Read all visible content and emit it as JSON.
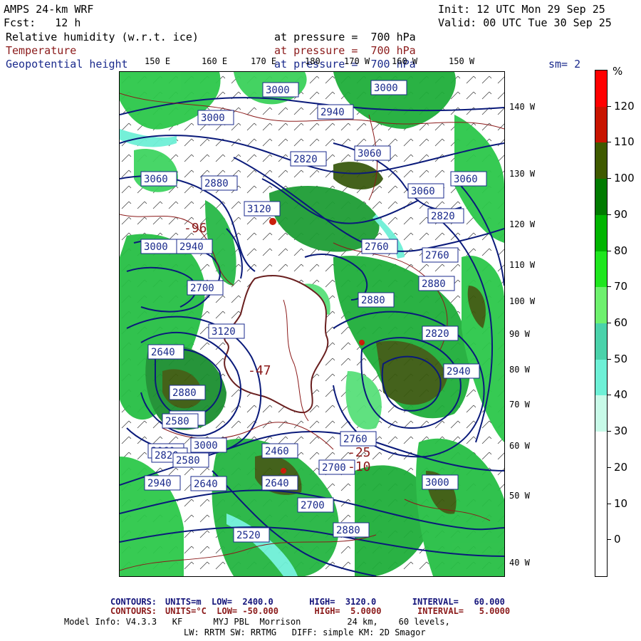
{
  "header": {
    "title": "AMPS 24-km WRF",
    "fcst": "Fcst:   12 h",
    "init": "Init: 12 UTC Mon 29 Sep 25",
    "valid": "Valid: 00 UTC Tue 30 Sep 25",
    "sm": "sm= 2"
  },
  "fields": [
    {
      "name": "Relative humidity (w.r.t. ice)",
      "pressure": "at pressure =  700 hPa",
      "color": "#000000"
    },
    {
      "name": "Temperature",
      "pressure": "at pressure =  700 hPa",
      "color": "#8b1a1a"
    },
    {
      "name": "Geopotential height",
      "pressure": "at pressure =  700 hPa",
      "color": "#1a2a8c"
    }
  ],
  "map": {
    "lon_labels": [
      "150 E",
      "160 E",
      "170 E",
      "180",
      "170 W",
      "160 W",
      "150 W"
    ],
    "lat_labels": [
      "140 W",
      "130 W",
      "120 W",
      "110 W",
      "100 W",
      "90 W",
      "80 W",
      "70 W",
      "60 W",
      "50 W",
      "40 W"
    ],
    "height_labels": [
      "3000",
      "3000",
      "3000",
      "2940",
      "3060",
      "3060",
      "2820",
      "3060",
      "2880",
      "3060",
      "3120",
      "2820",
      "2760",
      "2760",
      "3000",
      "2940",
      "2880",
      "2700",
      "2880",
      "2820",
      "3120",
      "2940",
      "2640",
      "2880",
      "2580",
      "3060",
      "3000",
      "2700",
      "3000",
      "2940",
      "2760",
      "2640",
      "2700",
      "2580",
      "2820",
      "2640",
      "2460",
      "2580",
      "2520",
      "2880"
    ],
    "temp_labels": [
      "-47",
      "-25",
      "-10",
      "-96"
    ]
  },
  "colorbar": {
    "unit": "%",
    "labels": [
      "120",
      "110",
      "100",
      "90",
      "80",
      "70",
      "60",
      "50",
      "40",
      "30",
      "20",
      "10",
      "0"
    ],
    "colors": [
      "#ff0000",
      "#c81400",
      "#3f5a00",
      "#007a00",
      "#00b400",
      "#1ee61e",
      "#6ef06e",
      "#4ad2aa",
      "#6ef0d6",
      "#c8fae8",
      "#ffffff",
      "#ffffff",
      "#ffffff",
      "#ffffff"
    ]
  },
  "footer": {
    "line1_label": "CONTOURS:",
    "line1": "UNITS=m  LOW=  2400.0       HIGH=  3120.0       INTERVAL=   60.000",
    "line2_label": "CONTOURS:",
    "line2": "UNITS=°C  LOW= -50.000       HIGH=  5.0000       INTERVAL=   5.0000",
    "line3": "Model Info: V4.3.3   KF      MYJ PBL  Morrison         24 km,    60 levels,",
    "line4": "LW: RRTM SW: RRTMG   DIFF: simple KM: 2D Smagor"
  }
}
